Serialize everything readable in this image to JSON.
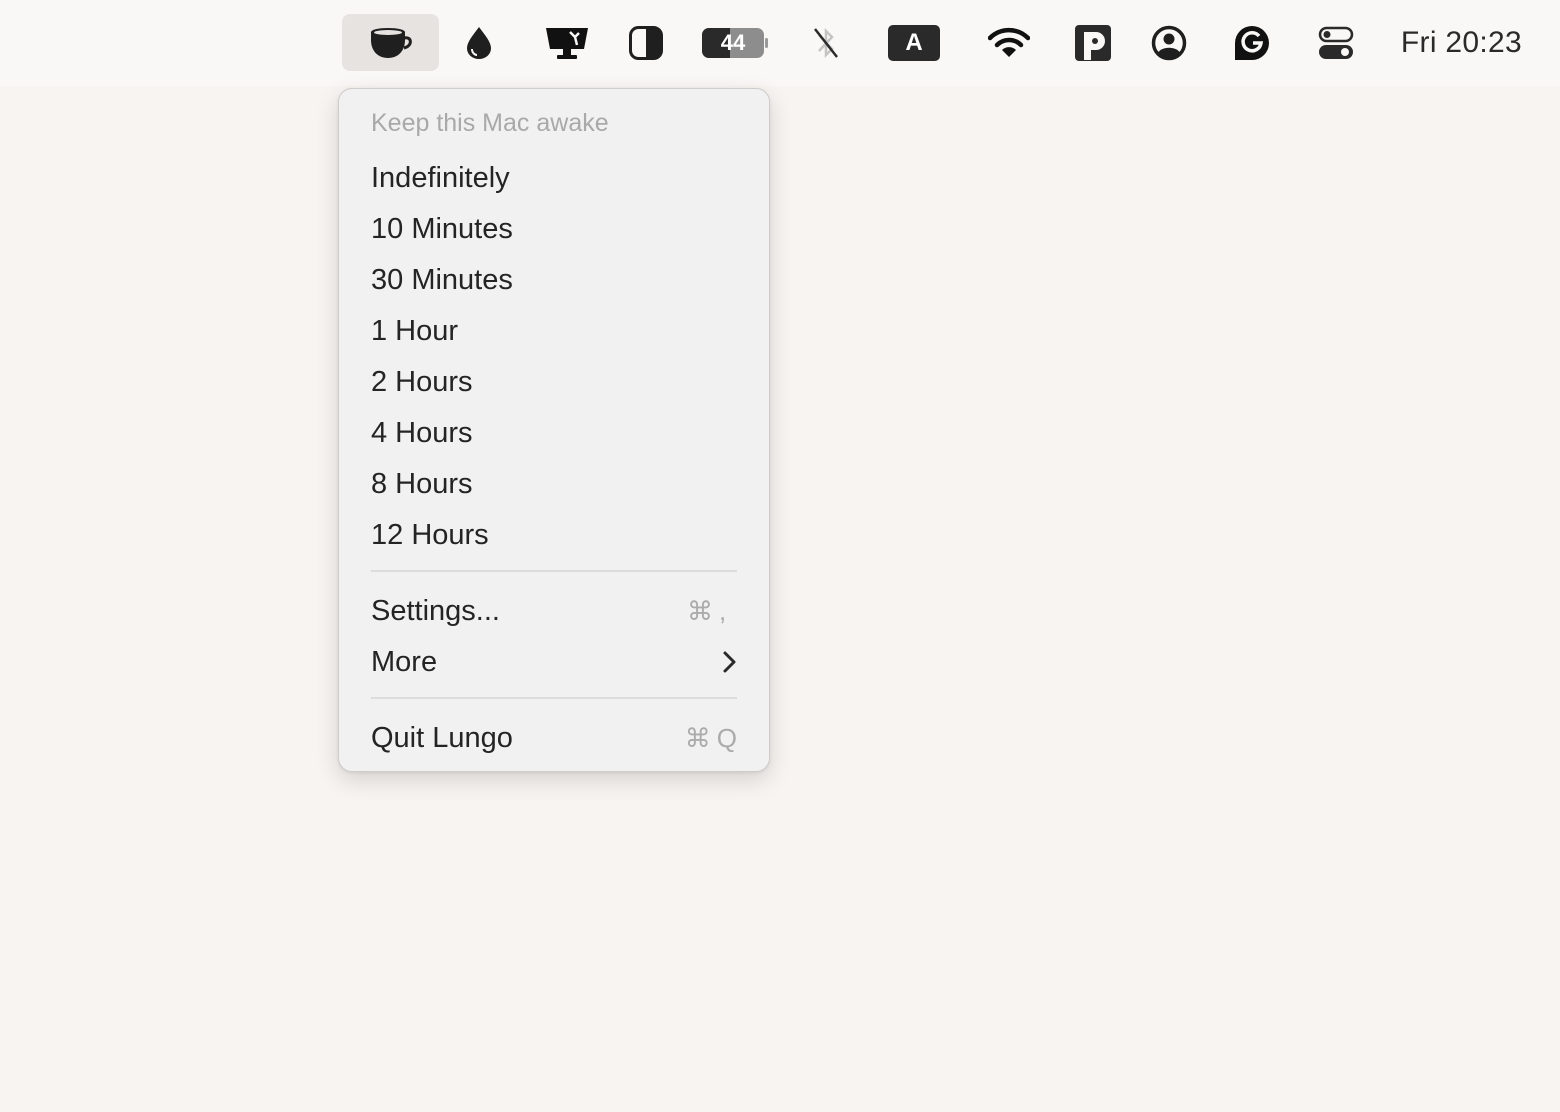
{
  "menubar": {
    "items": [
      {
        "name": "lungo-coffee-cup-icon",
        "active": true
      },
      {
        "name": "ink-drop-icon"
      },
      {
        "name": "display-icon"
      },
      {
        "name": "contrast-icon"
      },
      {
        "name": "battery-icon",
        "battery_level": "44"
      },
      {
        "name": "bluetooth-off-icon"
      },
      {
        "name": "input-source-icon",
        "letter": "A"
      },
      {
        "name": "wifi-icon"
      },
      {
        "name": "p-app-icon"
      },
      {
        "name": "user-account-icon"
      },
      {
        "name": "grammarly-icon"
      },
      {
        "name": "control-center-icon"
      }
    ],
    "clock": "Fri 20:23"
  },
  "menu": {
    "header": "Keep this Mac awake",
    "durations": [
      "Indefinitely",
      "10 Minutes",
      "30 Minutes",
      "1 Hour",
      "2 Hours",
      "4 Hours",
      "8 Hours",
      "12 Hours"
    ],
    "settings": {
      "label": "Settings...",
      "shortcut_symbol": "⌘",
      "shortcut_key": ","
    },
    "more": {
      "label": "More"
    },
    "quit": {
      "label": "Quit Lungo",
      "shortcut_symbol": "⌘",
      "shortcut_key": "Q"
    }
  }
}
